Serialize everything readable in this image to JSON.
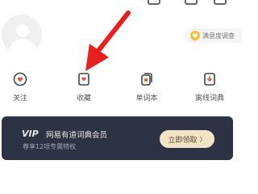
{
  "survey": {
    "label": "满意度调查",
    "icon": "heart-icon",
    "accent": "#f2c23a"
  },
  "menu": [
    {
      "label": "关注",
      "icon": "follow-heart-icon"
    },
    {
      "label": "收藏",
      "icon": "bookmark-icon"
    },
    {
      "label": "单词本",
      "icon": "wordbook-icon"
    },
    {
      "label": "离线词典",
      "icon": "offline-dictionary-icon"
    }
  ],
  "vip": {
    "logo": "VIP",
    "title": "网易有道词典会员",
    "subtitle": "尊享12项专属特权",
    "button_label": "立即领取",
    "button_chevron": "〉"
  },
  "colors": {
    "arrow": "#e8211f",
    "icon_accent": "#e8564a",
    "vip_bg": "#2e3245",
    "vip_button": "#f4e4c6"
  }
}
